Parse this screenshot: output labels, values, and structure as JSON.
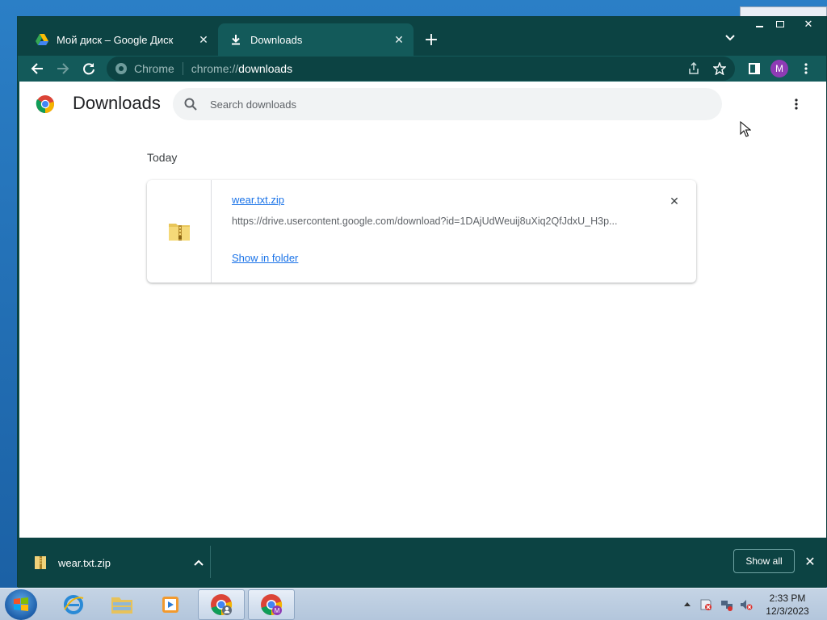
{
  "browser": {
    "tabs": [
      {
        "label": "Мой диск – Google Диск",
        "icon": "google-drive-icon"
      },
      {
        "label": "Downloads",
        "icon": "download-icon",
        "active": true
      }
    ],
    "omnibox": {
      "chip": "Chrome",
      "url_scheme": "chrome://",
      "url_host": "downloads"
    },
    "profile_initial": "M",
    "accent_color": "#135a5a"
  },
  "page": {
    "title": "Downloads",
    "search_placeholder": "Search downloads",
    "date_group": "Today",
    "items": [
      {
        "filename": "wear.txt.zip",
        "url": "https://drive.usercontent.google.com/download?id=1DAjUdWeuij8uXiq2QfJdxU_H3p...",
        "action": "Show in folder",
        "icon": "zip-folder-icon"
      }
    ]
  },
  "shelf": {
    "filename": "wear.txt.zip",
    "show_all": "Show all"
  },
  "taskbar": {
    "time": "2:33 PM",
    "date": "12/3/2023"
  }
}
